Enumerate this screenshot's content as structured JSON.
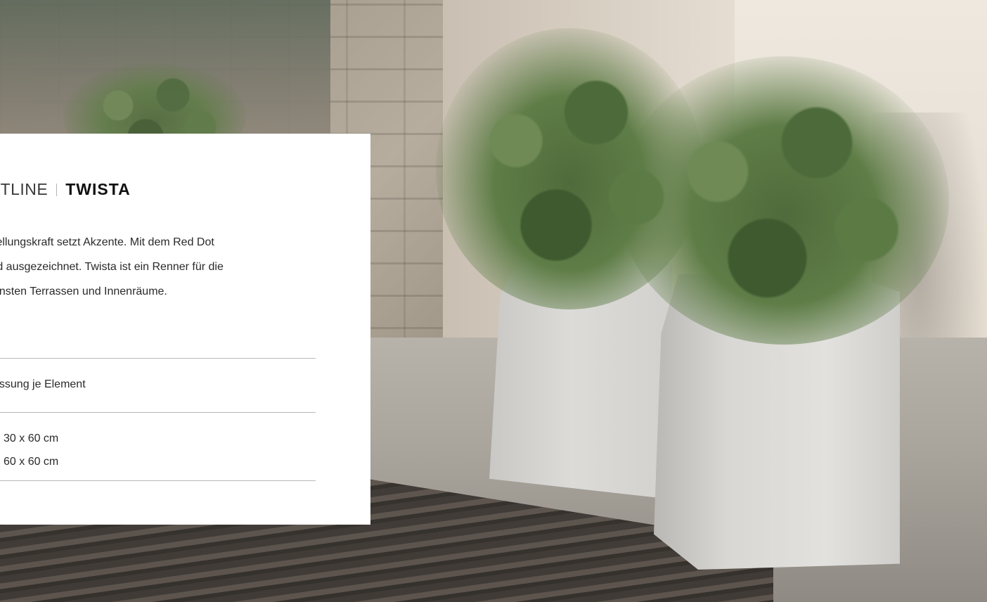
{
  "card": {
    "brand": "FTLINE",
    "product": "TWISTA",
    "description_lines": [
      "tellungskraft setzt Akzente. Mit dem Red Dot",
      "rd ausgezeichnet. Twista ist ein Renner für die",
      "önsten Terrassen und Innenräume."
    ],
    "spec_label": "essung je Element",
    "dimensions": [
      "30 x 60 cm",
      "60 x 60 cm"
    ]
  }
}
